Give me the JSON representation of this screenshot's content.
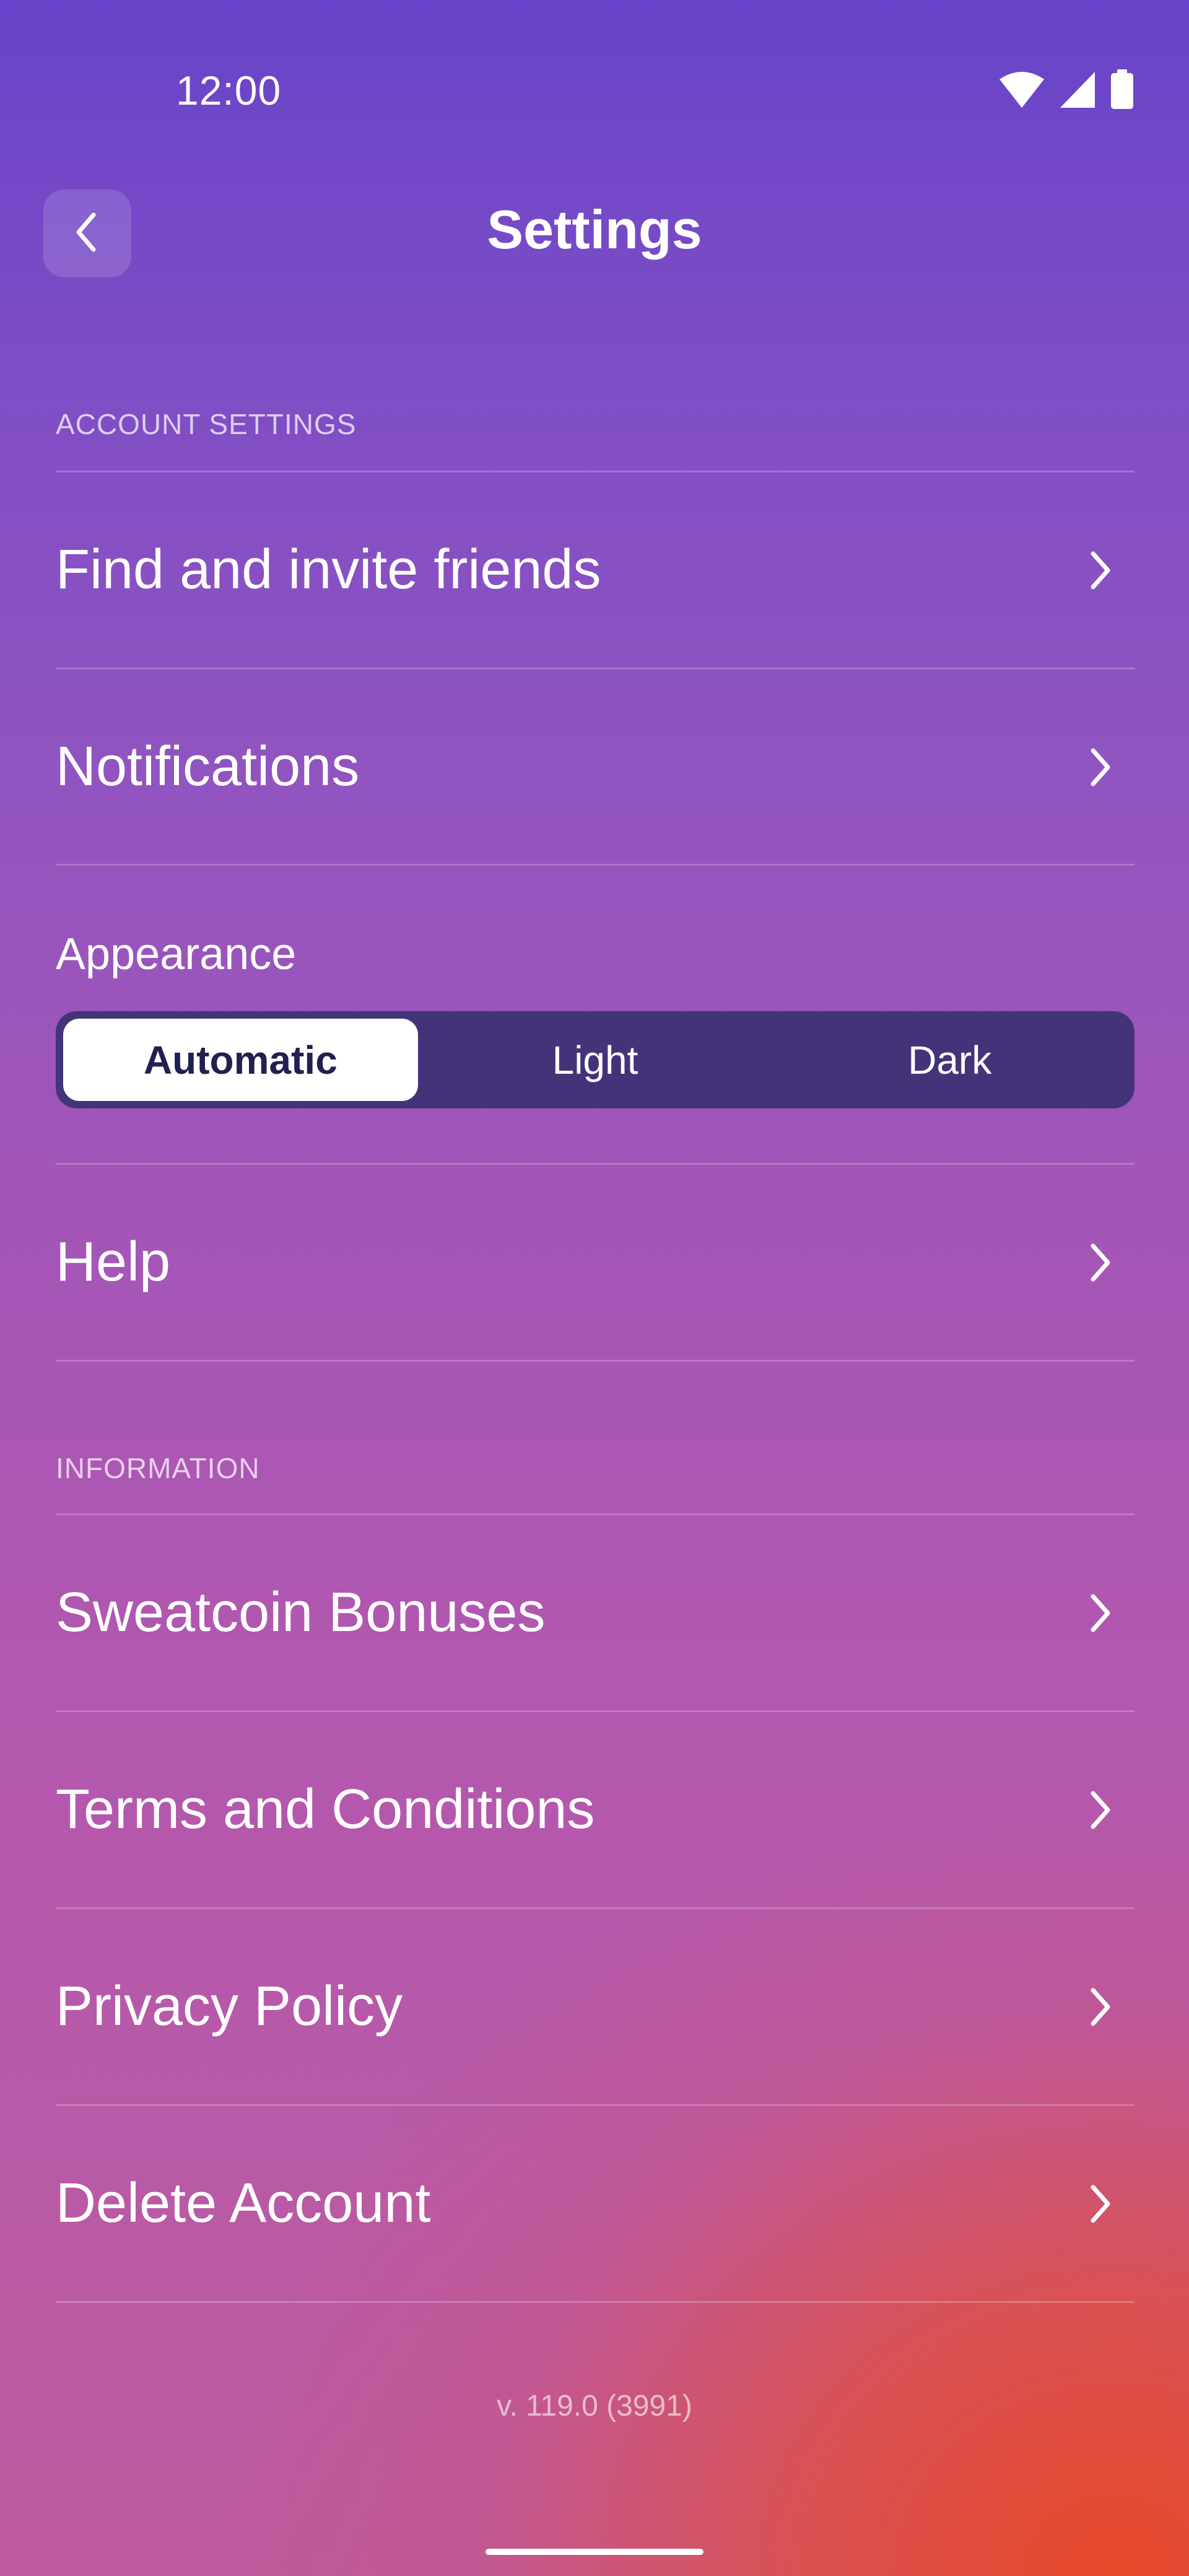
{
  "status_bar": {
    "time": "12:00",
    "icons": [
      "wifi-icon",
      "cellular-signal-icon",
      "battery-icon"
    ]
  },
  "header": {
    "title": "Settings",
    "back_icon": "chevron-left-icon"
  },
  "sections": {
    "account_settings_label": "ACCOUNT SETTINGS",
    "information_label": "INFORMATION"
  },
  "rows": {
    "find_friends": "Find and invite friends",
    "notifications": "Notifications",
    "help": "Help",
    "sweatcoin_bonuses": "Sweatcoin Bonuses",
    "terms": "Terms and Conditions",
    "privacy": "Privacy Policy",
    "delete_account": "Delete Account"
  },
  "appearance": {
    "label": "Appearance",
    "options": [
      "Automatic",
      "Light",
      "Dark"
    ],
    "selected": "Automatic"
  },
  "footer": {
    "version": "v. 119.0 (3991)"
  },
  "colors": {
    "gradient_top": "#6744c9",
    "gradient_mid": "#a656b6",
    "gradient_bottom_accent": "#e74828",
    "segmented_bg": "#433479",
    "selected_text": "#1f2150"
  }
}
